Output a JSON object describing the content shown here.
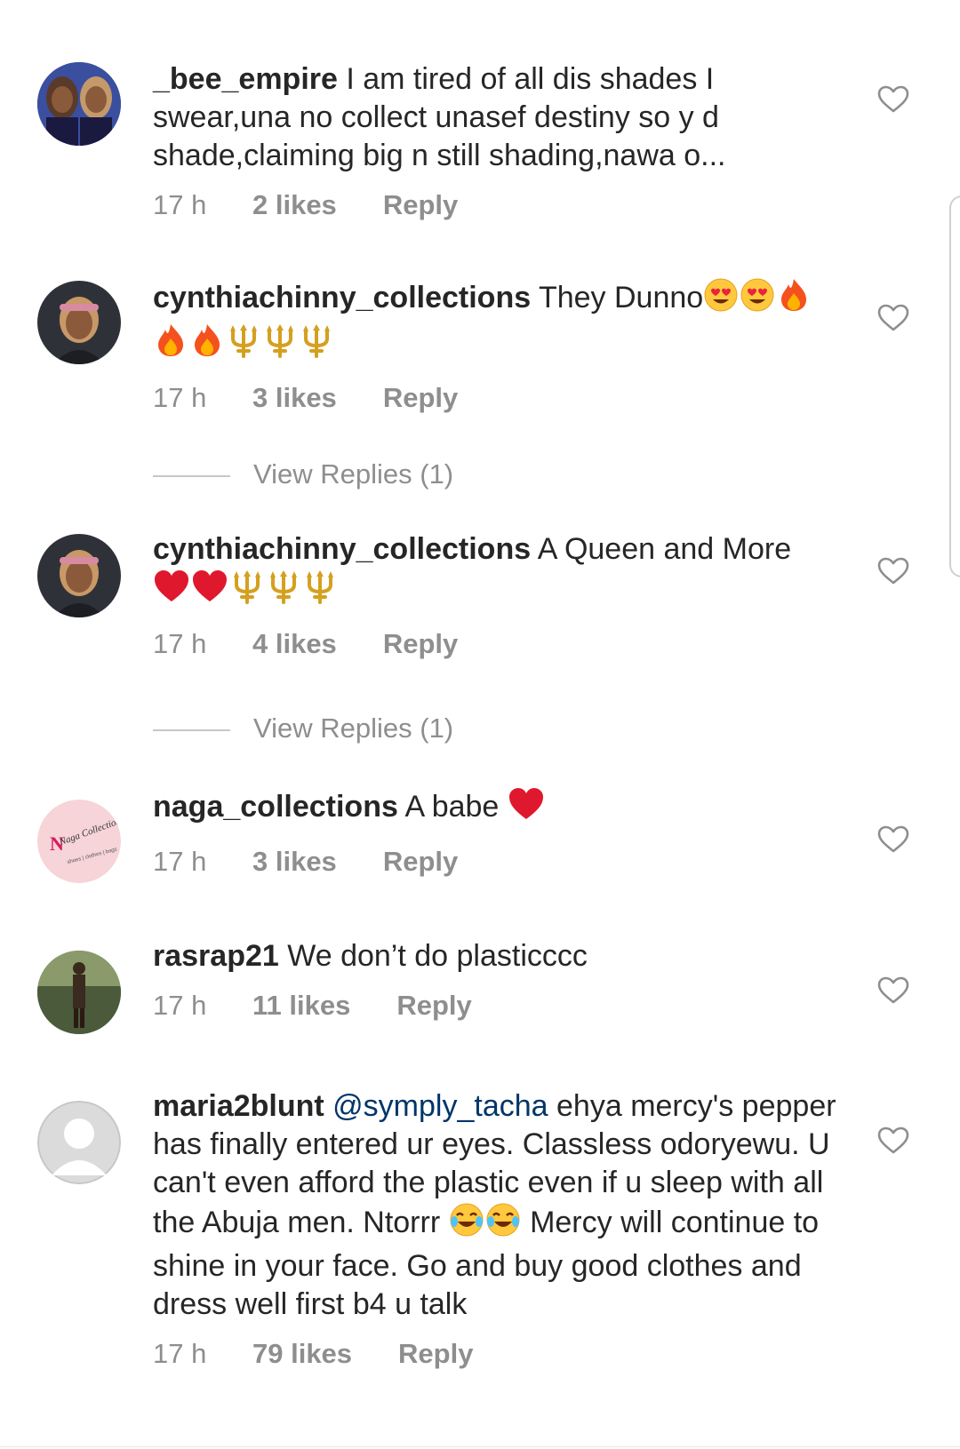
{
  "comments": [
    {
      "username": "_bee_empire",
      "text": "I am tired of all dis shades I swear,una no collect unasef destiny so y d shade,claiming big n still shading,nawa o...",
      "emojis": [],
      "time": "17 h",
      "likes": "2 likes",
      "reply": "Reply",
      "avatar": "avatar-two-women-icon"
    },
    {
      "username": "cynthiachinny_collections",
      "text": "They Dunno",
      "emojis": [
        "heart-eyes",
        "heart-eyes",
        "fire",
        "fire",
        "fire",
        "trident",
        "trident",
        "trident"
      ],
      "time": "17 h",
      "likes": "3 likes",
      "reply": "Reply",
      "view_replies": "View Replies (1)",
      "avatar": "avatar-woman-headband-icon"
    },
    {
      "username": "cynthiachinny_collections",
      "text": "A Queen and More",
      "emojis": [
        "red-heart",
        "red-heart",
        "trident",
        "trident",
        "trident"
      ],
      "time": "17 h",
      "likes": "4 likes",
      "reply": "Reply",
      "view_replies": "View Replies (1)",
      "avatar": "avatar-woman-headband-icon"
    },
    {
      "username": "naga_collections",
      "text": "A babe",
      "emojis": [
        "red-heart"
      ],
      "time": "17 h",
      "likes": "3 likes",
      "reply": "Reply",
      "avatar": "avatar-naga-collections-logo",
      "logo_text": "Naga Collections",
      "logo_subtext": "shoes | clothes | bags"
    },
    {
      "username": "rasrap21",
      "text": "We don’t do plasticccc",
      "emojis": [],
      "time": "17 h",
      "likes": "11 likes",
      "reply": "Reply",
      "avatar": "avatar-man-standing-icon"
    },
    {
      "username": "maria2blunt",
      "mention": "@symply_tacha",
      "text": "ehya mercy's pepper has finally entered ur eyes. Classless odoryewu. U can't even afford the plastic even if u sleep with all the Abuja men. Ntorrr",
      "emojis": [
        "tears-of-joy",
        "tears-of-joy"
      ],
      "text_after": "Mercy will continue to shine in your face. Go and buy good clothes and dress well first b4 u talk",
      "time": "17 h",
      "likes": "79 likes",
      "reply": "Reply",
      "avatar": "avatar-default-person-icon"
    }
  ],
  "colors": {
    "text": "#262626",
    "meta": "#8e8e8e",
    "mention": "#003569",
    "heart_outline": "#8e8e8e",
    "divider": "#c7c7c7"
  }
}
